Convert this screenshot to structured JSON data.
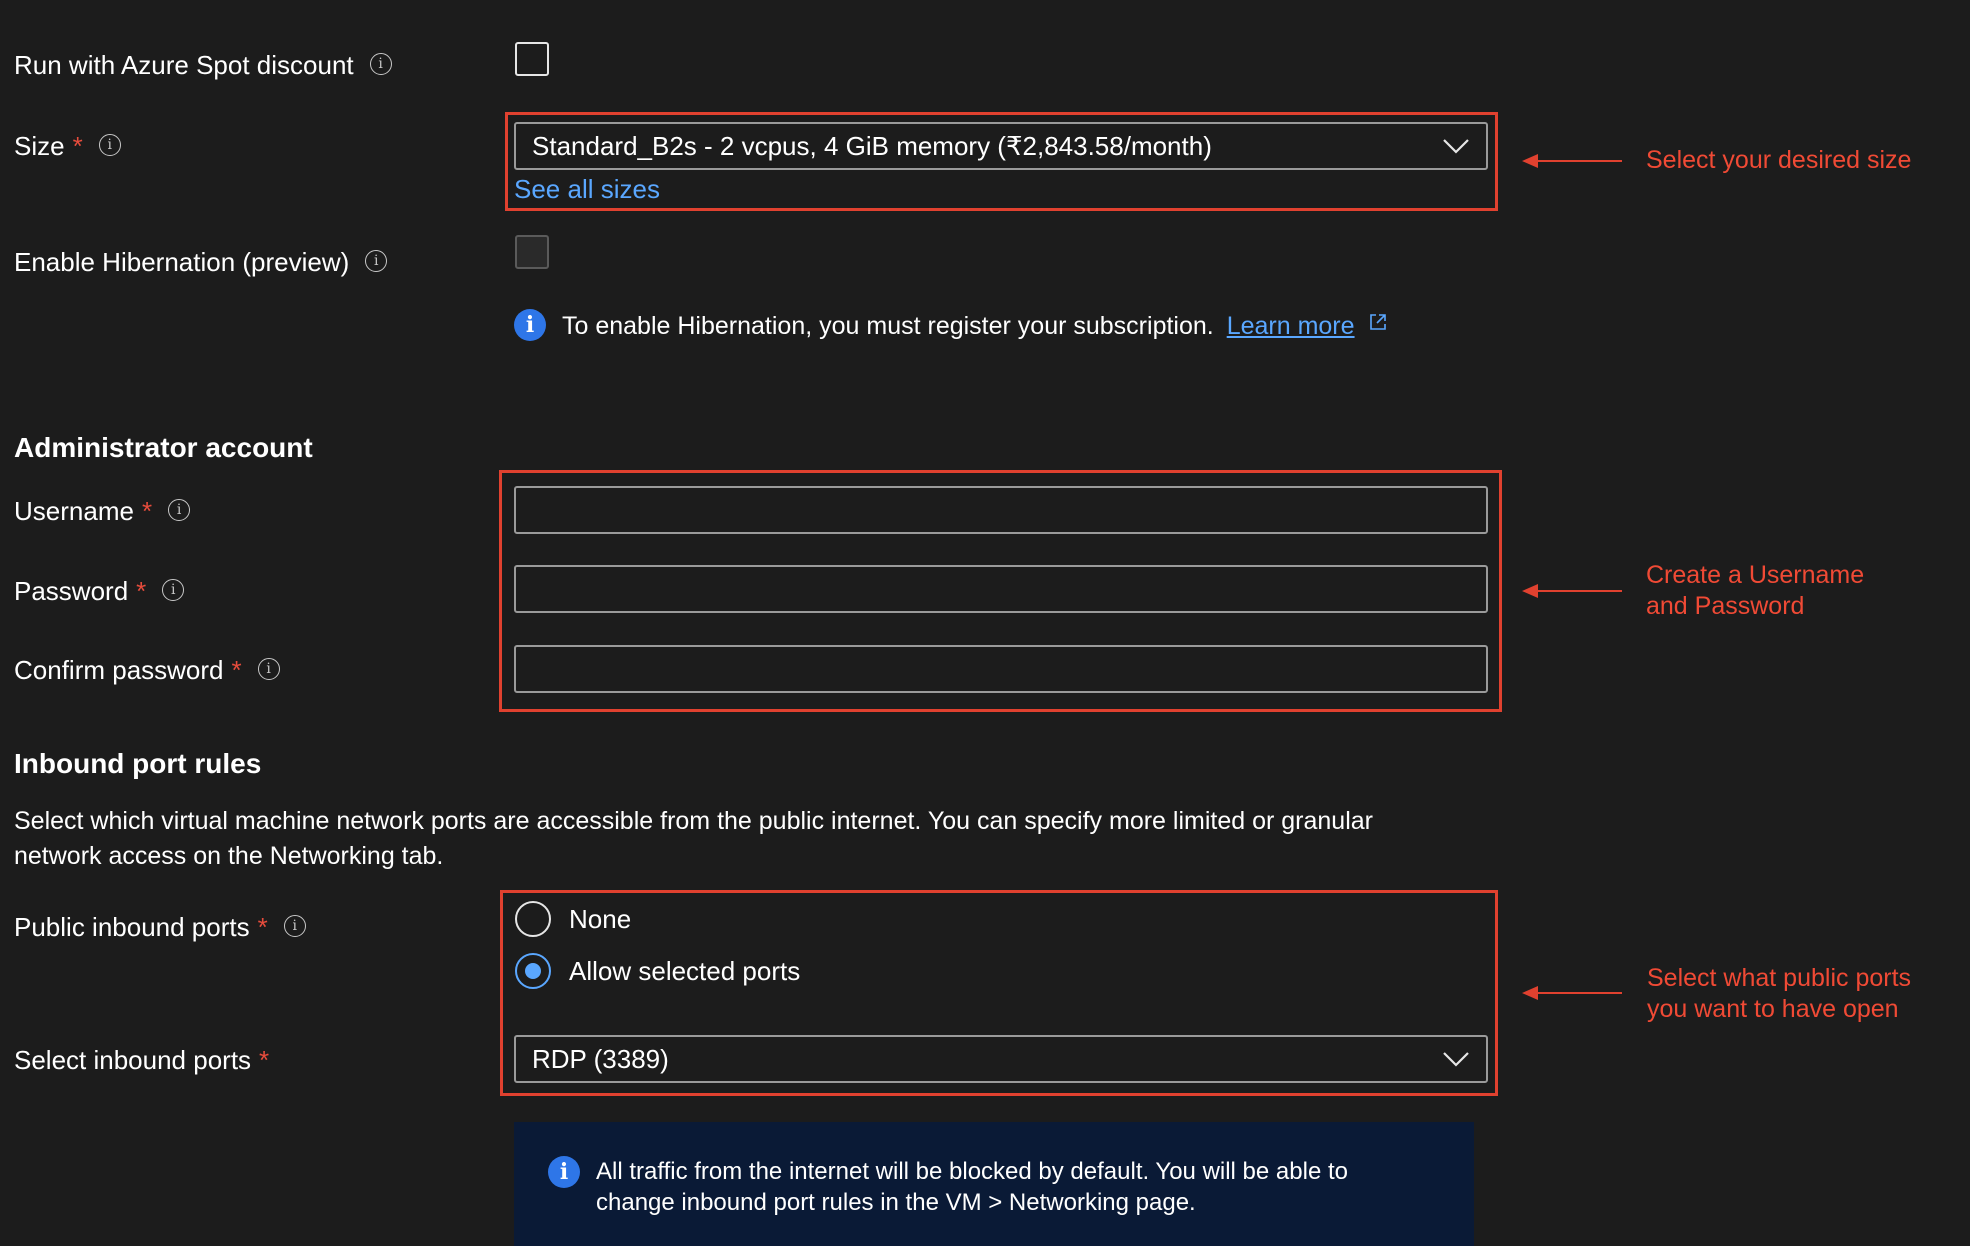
{
  "spot": {
    "label": "Run with Azure Spot discount",
    "checked": false
  },
  "size": {
    "label": "Size",
    "required_mark": "*",
    "value": "Standard_B2s - 2 vcpus, 4 GiB memory (₹2,843.58/month)",
    "see_all_link": "See all sizes"
  },
  "hibernation": {
    "label": "Enable Hibernation (preview)",
    "checked": false,
    "info_text": "To enable Hibernation, you must register your subscription.",
    "learn_more": "Learn more"
  },
  "admin": {
    "heading": "Administrator account",
    "username": {
      "label": "Username",
      "required_mark": "*",
      "value": ""
    },
    "password": {
      "label": "Password",
      "required_mark": "*",
      "value": ""
    },
    "confirm": {
      "label": "Confirm password",
      "required_mark": "*",
      "value": ""
    }
  },
  "inbound": {
    "heading": "Inbound port rules",
    "description_line1": "Select which virtual machine network ports are accessible from the public internet. You can specify more limited or granular",
    "description_line2": "network access on the Networking tab.",
    "public_ports": {
      "label": "Public inbound ports",
      "required_mark": "*",
      "options": [
        "None",
        "Allow selected ports"
      ],
      "selected": "Allow selected ports"
    },
    "select_ports": {
      "label": "Select inbound ports",
      "required_mark": "*",
      "value": "RDP (3389)"
    },
    "notice_line1": "All traffic from the internet will be blocked by default. You will be able to",
    "notice_line2": "change inbound port rules in the VM > Networking page."
  },
  "annotations": {
    "size": "Select your desired size",
    "credentials_line1": "Create a Username",
    "credentials_line2": "and Password",
    "ports_line1": "Select what public ports",
    "ports_line2": "you want to have open"
  },
  "colors": {
    "background": "#1c1c1c",
    "annotation_red": "#e0412f",
    "link_blue": "#5aa7ff",
    "notice_bg": "#0a1a36"
  }
}
